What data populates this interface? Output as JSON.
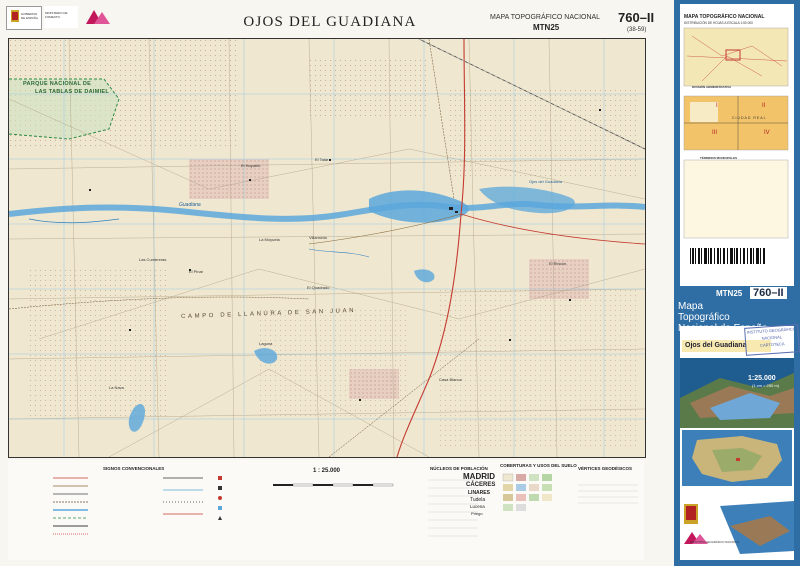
{
  "header": {
    "title": "OJOS DEL GUADIANA",
    "series": "MAPA TOPOGRÁFICO NACIONAL",
    "series_code": "MTN25",
    "sheet_number": "760–II",
    "sheet_code": "(38-59)",
    "logo1_text": "GOBIERNO DE ESPAÑA",
    "logo2_text": "MINISTERIO DE FOMENTO"
  },
  "map": {
    "labels": {
      "park": "PARQUE NACIONAL DE",
      "park2": "LAS TABLAS DE DAIMIEL",
      "plain": "CAMPO DE LLANURA DE SAN JUAN",
      "guadiana": "Guadiana",
      "ojos": "Ojos del Guadiana",
      "villarrubia": "Villarrubia",
      "el_talar": "El Talar",
      "el_hoyuelo": "El Hoyuelo",
      "la_moyuela": "La Moyuela",
      "las_cumbreras": "Las Cumbreras",
      "el_pinar": "El Pinar",
      "el_quadrado": "El Quadrado",
      "el_rincon": "El Rincón",
      "laguna": "Laguna",
      "la_nava": "La Nava",
      "casa_blanca": "Casa Blanca"
    },
    "colors": {
      "land": "#efe7cf",
      "water": "#5aa7dc",
      "vineyard": "#d9a9a6",
      "grid": "#9dc9e6",
      "road": "#c53a30"
    }
  },
  "legend": {
    "signos": "SIGNOS CONVENCIONALES",
    "scale": "1 : 25.000",
    "nucleos": "NÚCLEOS DE POBLACIÓN",
    "cobertura": "COBERTURAS Y USOS DEL SUELO",
    "vertices": "VÉRTICES GEODÉSICOS",
    "madrid": "MADRID",
    "caceres": "CÁCERES",
    "linares": "LINARES",
    "tudela": "Tudela",
    "lucena": "Lucena",
    "priego": "Priego"
  },
  "cover": {
    "title": "MAPA TOPOGRÁFICO NACIONAL",
    "subtitle": "DISTRIBUCIÓN DE HOJAS A ESCALA 1:50.000",
    "division": "DIVISIÓN ADMINISTRATIVA",
    "terminos": "TÉRMINOS MUNICIPALES",
    "ciudad_real": "CIUDAD REAL",
    "q1": "I",
    "q2": "II",
    "q3": "III",
    "q4": "IV",
    "mtn_code": "MTN25",
    "sheet_number": "760–II",
    "name_line1": "Mapa",
    "name_line2": "Topográfico",
    "name_line3": "Nacional de España",
    "place": "Ojos del Guadiana",
    "stamp1": "INSTITUTO GEOGRÁFICO",
    "stamp2": "NACIONAL",
    "stamp3": "CARTOTECA",
    "scale": "1:25.000",
    "scale_sub": "(1 cm = 250 m)",
    "publisher": "INSTITUTO GEOGRÁFICO NACIONAL"
  }
}
